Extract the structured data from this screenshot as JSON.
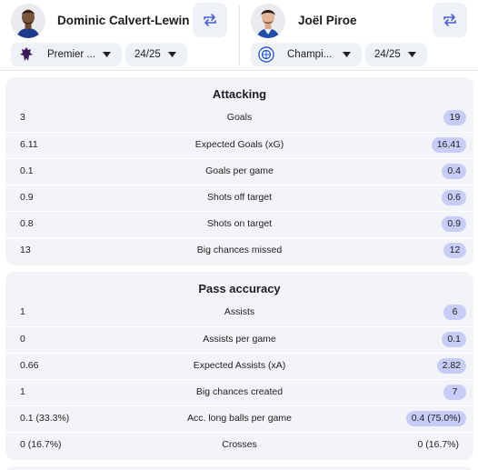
{
  "players": {
    "left": {
      "name": "Dominic Calvert-Lewin",
      "league": "Premier ...",
      "league_logo": "premier-league-logo",
      "season": "24/25"
    },
    "right": {
      "name": "Joël Piroe",
      "league": "Champi...",
      "league_logo": "championship-logo",
      "season": "24/25"
    }
  },
  "colors": {
    "highlight": "#c7cdf6",
    "card_bg": "#f3f4f7",
    "button_bg": "#eef1f6",
    "swap_icon": "#4a5fd9"
  },
  "sections": [
    {
      "title": "Attacking",
      "rows": [
        {
          "left": "3",
          "label": "Goals",
          "right": "19",
          "highlight": true
        },
        {
          "left": "6.11",
          "label": "Expected Goals (xG)",
          "right": "16.41",
          "highlight": true
        },
        {
          "left": "0.1",
          "label": "Goals per game",
          "right": "0.4",
          "highlight": true
        },
        {
          "left": "0.9",
          "label": "Shots off target",
          "right": "0.6",
          "highlight": true
        },
        {
          "left": "0.8",
          "label": "Shots on target",
          "right": "0.9",
          "highlight": true
        },
        {
          "left": "13",
          "label": "Big chances missed",
          "right": "12",
          "highlight": true
        }
      ]
    },
    {
      "title": "Pass accuracy",
      "rows": [
        {
          "left": "1",
          "label": "Assists",
          "right": "6",
          "highlight": true
        },
        {
          "left": "0",
          "label": "Assists per game",
          "right": "0.1",
          "highlight": true
        },
        {
          "left": "0.66",
          "label": "Expected Assists (xA)",
          "right": "2.82",
          "highlight": true
        },
        {
          "left": "1",
          "label": "Big chances created",
          "right": "7",
          "highlight": true
        },
        {
          "left": "0.1 (33.3%)",
          "label": "Acc. long balls per game",
          "right": "0.4 (75.0%)",
          "highlight": true
        },
        {
          "left": "0 (16.7%)",
          "label": "Crosses",
          "right": "0 (16.7%)",
          "highlight": false
        }
      ]
    }
  ]
}
